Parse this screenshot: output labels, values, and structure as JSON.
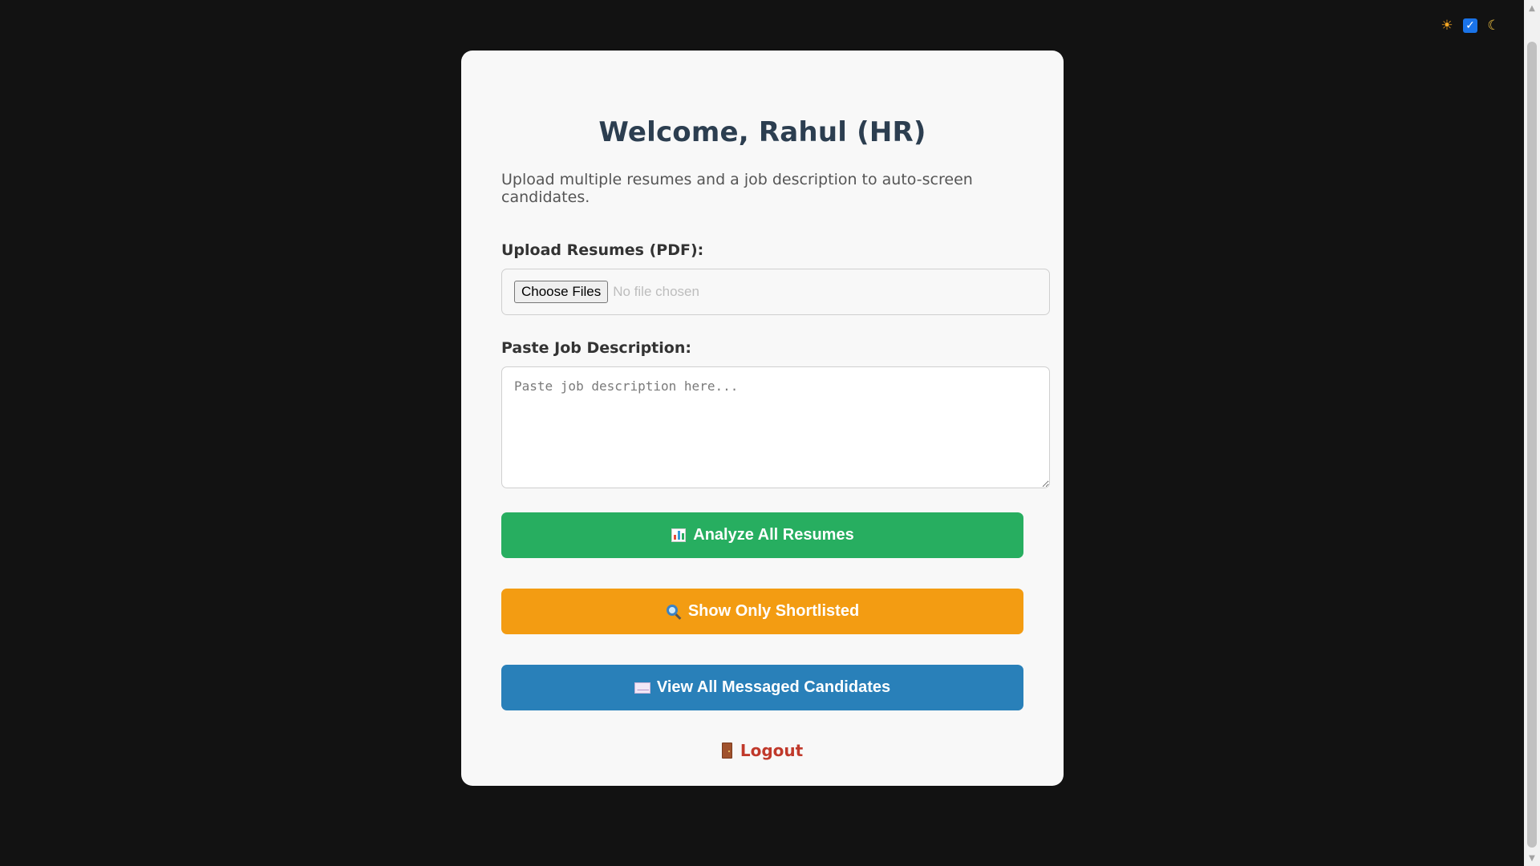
{
  "theme_toggle": {
    "light_icon": "sun-icon",
    "checkbox_checked": true,
    "dark_icon": "moon-icon"
  },
  "card": {
    "title": "Welcome, Rahul (HR)",
    "subtitle": "Upload multiple resumes and a job description to auto-screen candidates.",
    "upload": {
      "label": "Upload Resumes (PDF):",
      "button_label": "Choose Files",
      "status_text": "No file chosen"
    },
    "job_description": {
      "label": "Paste Job Description:",
      "placeholder": "Paste job description here...",
      "value": ""
    },
    "actions": {
      "analyze": {
        "icon": "bar-chart-icon",
        "label": "Analyze All Resumes",
        "color": "#27ae60"
      },
      "shortlist": {
        "icon": "magnifier-icon",
        "label": "Show Only Shortlisted",
        "color": "#f39c12"
      },
      "messaged": {
        "icon": "envelope-icon",
        "label": "View All Messaged Candidates",
        "color": "#2980b9"
      }
    },
    "logout": {
      "icon": "door-icon",
      "label": "Logout",
      "color": "#c0392b"
    }
  },
  "colors": {
    "page_background": "#121212",
    "card_background": "#f8f8f8",
    "title": "#2c3e50"
  }
}
